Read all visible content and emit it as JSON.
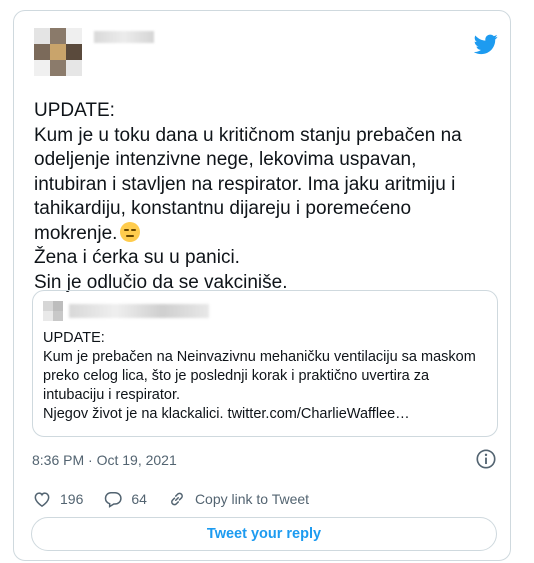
{
  "tweet": {
    "text_lines": [
      "UPDATE:",
      "Kum je u toku dana u kritičnom stanju prebačen na",
      "odeljenje intenzivne nege, lekovima uspavan,",
      "intubiran i stavljen na respirator. Ima jaku aritmiju i",
      "tahikardiju, konstantnu dijareju i poremećeno",
      "mokrenje.",
      "Žena i ćerka su u panici.",
      "Sin je odlučio da se vakciniše."
    ],
    "emoji": "pensive-face-icon",
    "timestamp": "8:36 PM · Oct 19, 2021"
  },
  "quote": {
    "lines": [
      "UPDATE:",
      "Kum je prebačen na Neinvazivnu mehaničku ventilaciju sa maskom",
      "preko celog lica, što je poslednji korak i praktično uvertira za",
      "intubaciju i respirator.",
      "Njegov život je na klackalici. twitter.com/CharlieWafflee…"
    ]
  },
  "actions": {
    "like_count": "196",
    "reply_count": "64",
    "copy_link_label": "Copy link to Tweet"
  },
  "reply_button_label": "Tweet your reply",
  "colors": {
    "twitter_blue": "#1d9bf0",
    "text": "#0f1419",
    "secondary": "#536471",
    "border": "#cfd9de"
  }
}
